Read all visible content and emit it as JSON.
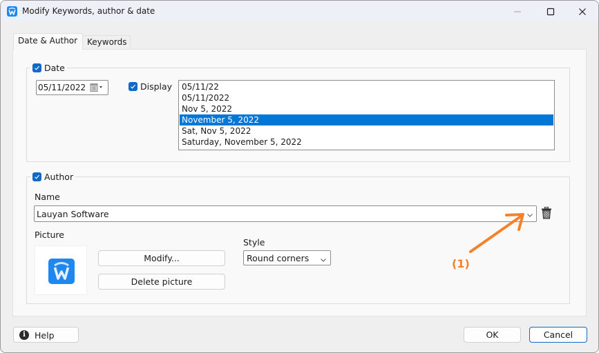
{
  "window": {
    "title": "Modify Keywords, author & date",
    "controls": {
      "minimize": "minimize",
      "maximize": "maximize",
      "close": "close"
    }
  },
  "tabs": [
    {
      "label": "Date & Author",
      "active": true
    },
    {
      "label": "Keywords",
      "active": false
    }
  ],
  "date_group": {
    "checkbox_label": "Date",
    "checked": true,
    "date_value": "05/11/2022",
    "display_label": "Display",
    "display_checked": true,
    "formats": [
      "05/11/22",
      "05/11/2022",
      "Nov 5, 2022",
      "November 5, 2022",
      "Sat, Nov 5, 2022",
      "Saturday, November 5, 2022"
    ],
    "selected_format": "November 5, 2022"
  },
  "author_group": {
    "checkbox_label": "Author",
    "checked": true,
    "name_label": "Name",
    "name_value": "Lauyan Software",
    "picture_label": "Picture",
    "modify_button": "Modify...",
    "delete_picture_button": "Delete picture",
    "style_label": "Style",
    "style_value": "Round corners"
  },
  "annotation": {
    "label": "(1)",
    "color": "#f5822a"
  },
  "footer": {
    "help_button": "Help",
    "ok_button": "OK",
    "cancel_button": "Cancel"
  },
  "colors": {
    "accent": "#1068c7",
    "selection": "#0277d8",
    "logo": "#1e88f0"
  }
}
